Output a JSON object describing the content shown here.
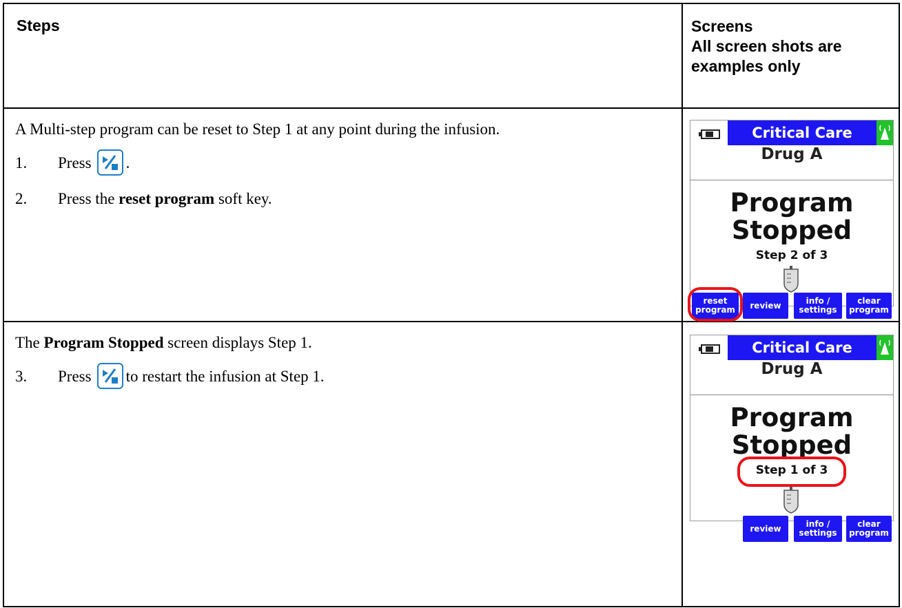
{
  "table": {
    "header_steps": "Steps",
    "header_screens_line1": "Screens",
    "header_screens_line2": "All screen shots are",
    "header_screens_line3": "examples only"
  },
  "row1": {
    "intro": "A Multi-step program can be reset to Step 1 at any point during the infusion.",
    "step1_num": "1.",
    "step1_text": "Press",
    "step1_after": ".",
    "step2_num": "2.",
    "step2_pre": "Press the",
    "step2_bold": "reset program",
    "step2_post": "soft key."
  },
  "row2": {
    "intro_bold": "Program Stopped",
    "intro_post": "screen displays Step 1.",
    "intro_pre": "The",
    "step3_num": "3.",
    "step3_pre": "Press",
    "step3_post": "to restart the infusion at Step 1."
  },
  "screen1": {
    "title": "Critical Care",
    "drug": "Drug A",
    "status_line1": "Program",
    "status_line2": "Stopped",
    "step": "Step 2 of 3",
    "softkeys": [
      "reset program",
      "review",
      "info / settings",
      "clear program"
    ],
    "highlight": "reset program"
  },
  "screen2": {
    "title": "Critical Care",
    "drug": "Drug A",
    "status_line1": "Program",
    "status_line2": "Stopped",
    "step": "Step 1 of 3",
    "softkeys": [
      "",
      "review",
      "info / settings",
      "clear program"
    ],
    "highlight": "Step 1 of 3"
  },
  "icons": {
    "run_stop_key": "run-stop-key-icon",
    "battery": "battery-icon",
    "wireless": "wireless-icon",
    "iv_bag": "iv-bag-icon"
  },
  "colors": {
    "title_bar": "#1e17f2",
    "wireless_box": "#22c22b",
    "highlight": "#e8141c",
    "key_border": "#1e7ec8"
  }
}
